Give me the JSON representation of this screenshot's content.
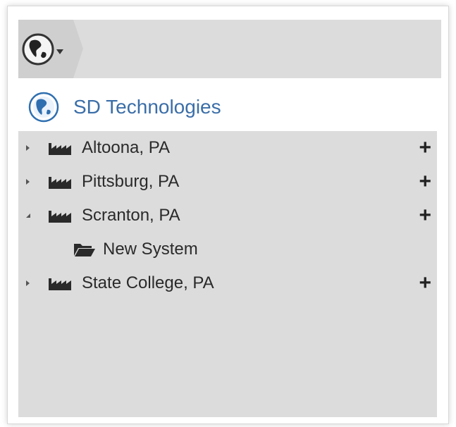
{
  "org": {
    "title": "SD Technologies"
  },
  "tree": {
    "locations": [
      {
        "label": "Altoona, PA",
        "expanded": false,
        "add_icon": "plus-icon"
      },
      {
        "label": "Pittsburg, PA",
        "expanded": false,
        "add_icon": "plus-icon"
      },
      {
        "label": "Scranton, PA",
        "expanded": true,
        "add_icon": "plus-icon",
        "children": [
          {
            "label": "New System",
            "icon": "folder-open-icon"
          }
        ]
      },
      {
        "label": "State College, PA",
        "expanded": false,
        "add_icon": "plus-icon"
      }
    ],
    "add_label": "+"
  },
  "colors": {
    "title_blue": "#3b6ea8",
    "panel_gray": "#dcdcdc",
    "chip_gray": "#cfcfcf",
    "globe_blue": "#2f6fb0"
  }
}
